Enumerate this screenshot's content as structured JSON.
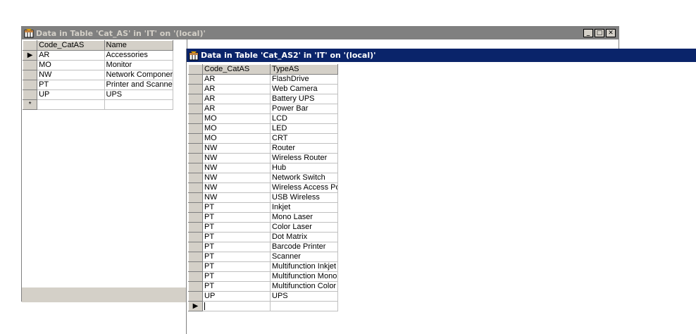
{
  "window1": {
    "title": "Data in Table 'Cat_AS' in 'IT' on '(local)'",
    "columns": [
      "Code_CatAS",
      "Name"
    ],
    "rows": [
      [
        "AR",
        "Accessories"
      ],
      [
        "MO",
        "Monitor"
      ],
      [
        "NW",
        "Network Componer"
      ],
      [
        "PT",
        "Printer and Scanne"
      ],
      [
        "UP",
        "UPS"
      ]
    ],
    "new_row_marker": "*",
    "current_row_marker": "▶",
    "controls": {
      "minimize": "_",
      "maximize": "□",
      "close": "✕"
    }
  },
  "window2": {
    "title": "Data in Table 'Cat_AS2' in 'IT' on '(local)'",
    "columns": [
      "Code_CatAS",
      "TypeAS"
    ],
    "rows": [
      [
        "AR",
        "FlashDrive"
      ],
      [
        "AR",
        "Web Camera"
      ],
      [
        "AR",
        "Battery UPS"
      ],
      [
        "AR",
        "Power Bar"
      ],
      [
        "MO",
        "LCD"
      ],
      [
        "MO",
        "LED"
      ],
      [
        "MO",
        "CRT"
      ],
      [
        "NW",
        "Router"
      ],
      [
        "NW",
        "Wireless Router"
      ],
      [
        "NW",
        "Hub"
      ],
      [
        "NW",
        "Network Switch"
      ],
      [
        "NW",
        "Wireless Access Po"
      ],
      [
        "NW",
        "USB Wireless"
      ],
      [
        "PT",
        "Inkjet"
      ],
      [
        "PT",
        "Mono Laser"
      ],
      [
        "PT",
        "Color Laser"
      ],
      [
        "PT",
        "Dot Matrix"
      ],
      [
        "PT",
        "Barcode Printer"
      ],
      [
        "PT",
        "Scanner"
      ],
      [
        "PT",
        "Multifunction Inkjet"
      ],
      [
        "PT",
        "Multifunction Mono"
      ],
      [
        "PT",
        "Multifunction Color"
      ],
      [
        "UP",
        "UPS"
      ]
    ],
    "current_row_marker": "▶"
  },
  "colors": {
    "inactive_title": "#808080",
    "active_title": "#0a246a",
    "face": "#d4d0c8"
  }
}
